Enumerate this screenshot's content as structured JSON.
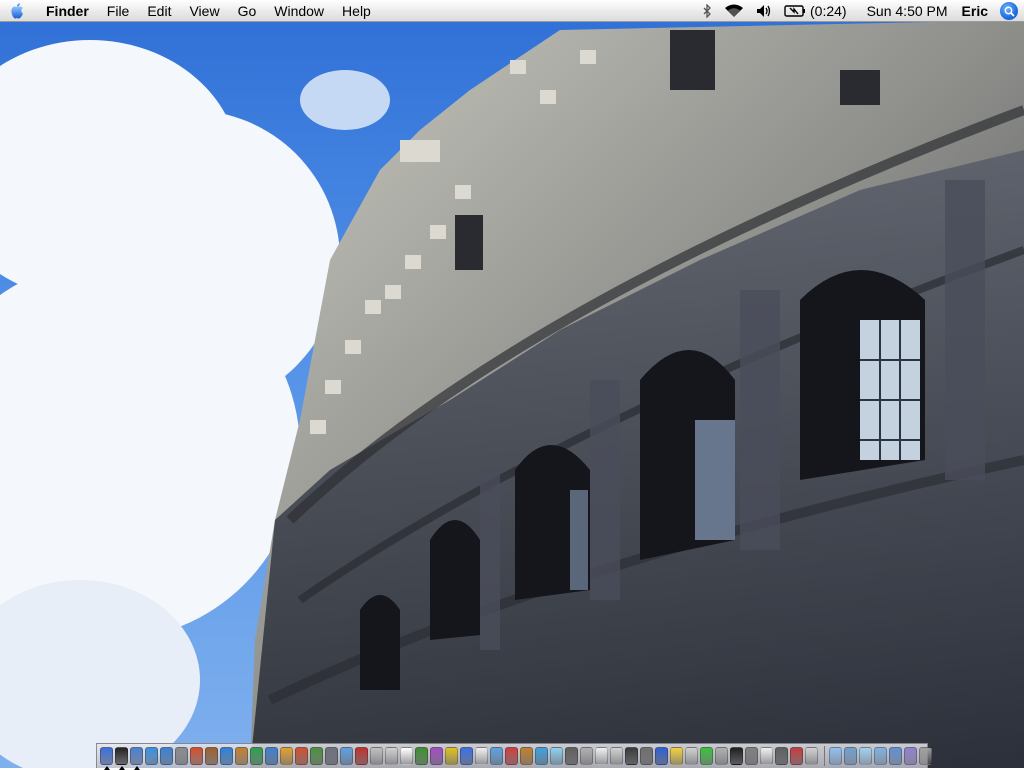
{
  "menubar": {
    "app_name": "Finder",
    "items": [
      "File",
      "Edit",
      "View",
      "Go",
      "Window",
      "Help"
    ],
    "status": {
      "battery_time": "(0:24)",
      "clock": "Sun 4:50 PM",
      "user": "Eric"
    },
    "icons": [
      "apple-icon",
      "bluetooth-icon",
      "wifi-icon",
      "volume-icon",
      "battery-icon",
      "spotlight-icon"
    ]
  },
  "dock": {
    "icon_colors": [
      "#3b6fd8",
      "#222222",
      "#4a7fd0",
      "#3a8fe0",
      "#3b7fd0",
      "#8a8a8a",
      "#d24f2a",
      "#9a5f2f",
      "#2f7fd8",
      "#c08030",
      "#2f9f4f",
      "#3f7fcf",
      "#e0a030",
      "#d05030",
      "#4f8f3f",
      "#6f6f7f",
      "#5f9fdf",
      "#c03030",
      "#bfbfbf",
      "#d0d0d0",
      "#ffffff",
      "#3f8f2f",
      "#9f4fbf",
      "#e0c020",
      "#3f6fdf",
      "#efefef",
      "#5fa0e0",
      "#cf3f3f",
      "#bf7f2f",
      "#3f9fdf",
      "#8fcfef",
      "#5f5f5f",
      "#afafaf",
      "#efefef",
      "#d0d0d0",
      "#3a3a3a",
      "#6f6f6f",
      "#2f5fcf",
      "#efd040",
      "#cfcfcf",
      "#3fbf3f",
      "#afafaf",
      "#1f1f1f",
      "#7f7f7f",
      "#efefef",
      "#5f5f5f",
      "#bf3f3f",
      "#d0d0d0"
    ],
    "right_colors": [
      "#8fbfef",
      "#6f9fcf",
      "#9fcfef",
      "#7fafdf",
      "#5f8fcf",
      "#8f7fcf",
      "#9f9f9f"
    ],
    "running": [
      0,
      1,
      2
    ]
  }
}
